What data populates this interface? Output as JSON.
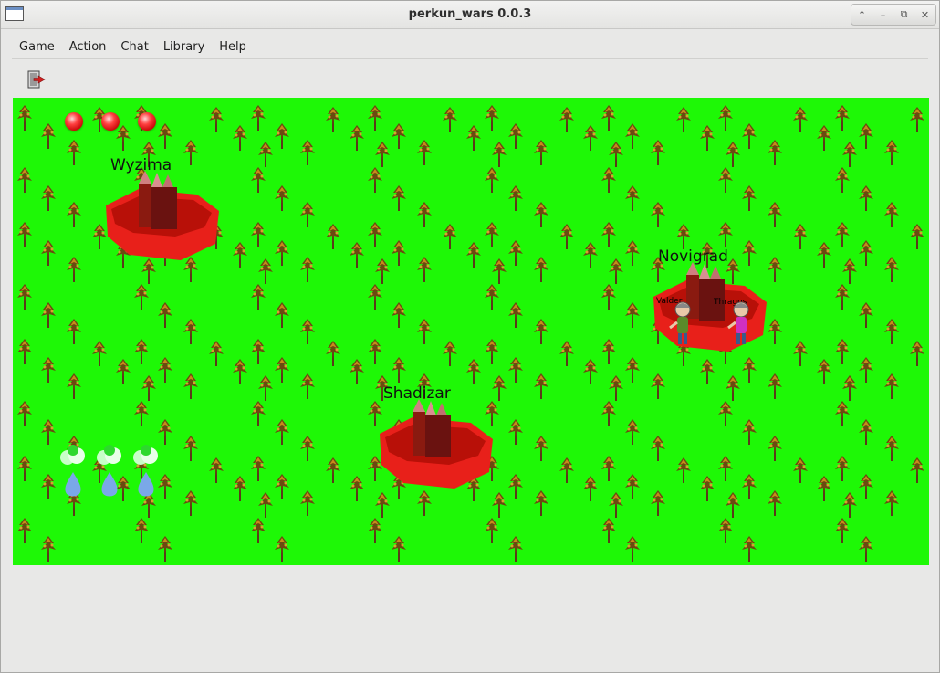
{
  "window": {
    "title": "perkun_wars 0.0.3"
  },
  "menu": [
    "Game",
    "Action",
    "Chat",
    "Library",
    "Help"
  ],
  "toolbar": {
    "exit_icon": "exit-door-icon"
  },
  "cities": [
    {
      "name": "Wyzima"
    },
    {
      "name": "Novigrad"
    },
    {
      "name": "Shadizar"
    }
  ],
  "characters": [
    {
      "name": "Valder",
      "shirt": "#5a8a2a"
    },
    {
      "name": "Thragos",
      "shirt": "#d030c0"
    }
  ],
  "colors": {
    "grass": "#1ef806",
    "castle": "#e8201a",
    "life_orb": "#ff2020"
  },
  "status": {
    "life_orbs": 3,
    "mana_potions": 3
  }
}
